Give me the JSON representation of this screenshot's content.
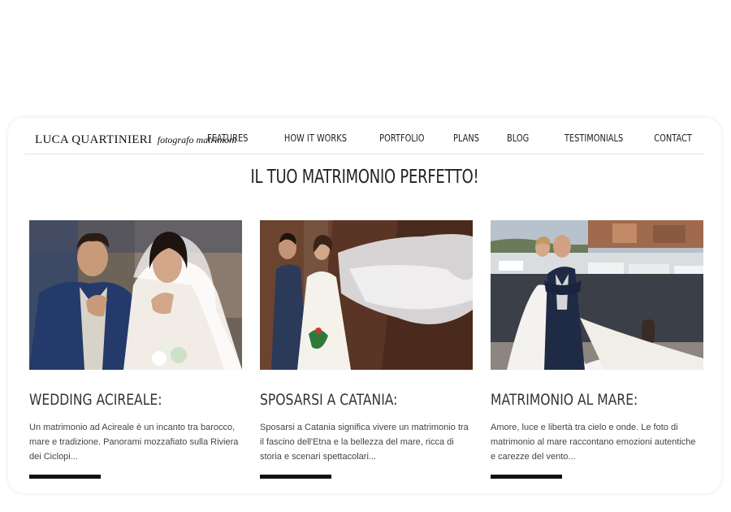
{
  "header": {
    "logo_name": "LUCA QUARTINIERI",
    "logo_sub": "fotografo matrimoni",
    "nav": [
      "FEATURES",
      "HOW IT WORKS",
      "PORTFOLIO",
      "PLANS",
      "BLOG",
      "TESTIMONIALS",
      "CONTACT"
    ]
  },
  "main": {
    "headline": "IL TUO MATRIMONIO PERFETTO!",
    "posts": [
      {
        "title": "WEDDING ACIREALE:",
        "excerpt": "Un matrimonio ad Acireale è un incanto tra barocco, mare e tradizione. Panorami mozzafiato sulla Riviera dei Ciclopi..."
      },
      {
        "title": "SPOSARSI A CATANIA:",
        "excerpt": "Sposarsi a Catania significa vivere un matrimonio tra il fascino dell'Etna e la bellezza del mare, ricca di storia e scenari spettacolari..."
      },
      {
        "title": "MATRIMONIO AL MARE:",
        "excerpt": "Amore, luce e libertà tra cielo e onde. Le foto di matrimonio al mare raccontano emozioni autentiche e carezze del vento..."
      }
    ]
  }
}
